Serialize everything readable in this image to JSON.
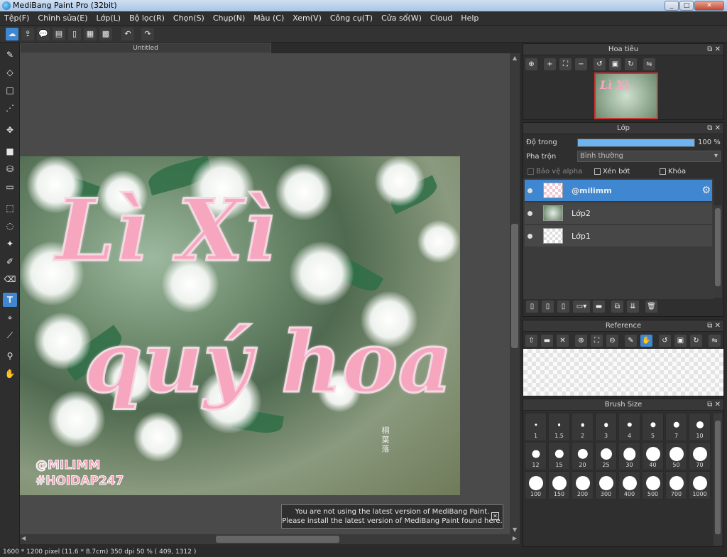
{
  "window": {
    "title": "MediBang Paint Pro (32bit)",
    "min": "_",
    "max": "□",
    "close": "✕"
  },
  "menu": [
    "Tệp(F)",
    "Chỉnh sửa(E)",
    "Lớp(L)",
    "Bộ lọc(R)",
    "Chọn(S)",
    "Chụp(N)",
    "Màu (C)",
    "Xem(V)",
    "Công cụ(T)",
    "Cửa sổ(W)",
    "Cloud",
    "Help"
  ],
  "document": {
    "tab_title": "Untitled"
  },
  "artwork": {
    "line1": "Lì Xì",
    "line2": "quý hoa",
    "tag1": "@MILIMM",
    "tag2": "#HOIDAP247",
    "stamp": "桐葉落"
  },
  "navigator": {
    "title": "Hoa tiêu"
  },
  "layers": {
    "title": "Lớp",
    "opacity_label": "Độ trong",
    "opacity_value": "100 %",
    "opacity_fraction": 1.0,
    "blend_label": "Pha trộn",
    "blend_value": "Bình thường",
    "protect_alpha": "Bảo vệ alpha",
    "clipping": "Xén bớt",
    "lock": "Khóa",
    "items": [
      {
        "name": "@milimm",
        "selected": true
      },
      {
        "name": "Lớp2",
        "selected": false
      },
      {
        "name": "Lớp1",
        "selected": false
      }
    ]
  },
  "reference": {
    "title": "Reference"
  },
  "brush": {
    "title": "Brush Size",
    "sizes": [
      "1",
      "1.5",
      "2",
      "3",
      "4",
      "5",
      "7",
      "10",
      "12",
      "15",
      "20",
      "25",
      "30",
      "40",
      "50",
      "70",
      "100",
      "150",
      "200",
      "300",
      "400",
      "500",
      "700",
      "1000"
    ]
  },
  "notice": {
    "line1": "You are not using the latest version of MediBang Paint.",
    "line2": "Please install the latest version of MediBang Paint found here."
  },
  "status": {
    "text": "1600 * 1200 pixel   (11.6 * 8.7cm)   350 dpi   50 %   ( 409, 1312 )"
  }
}
